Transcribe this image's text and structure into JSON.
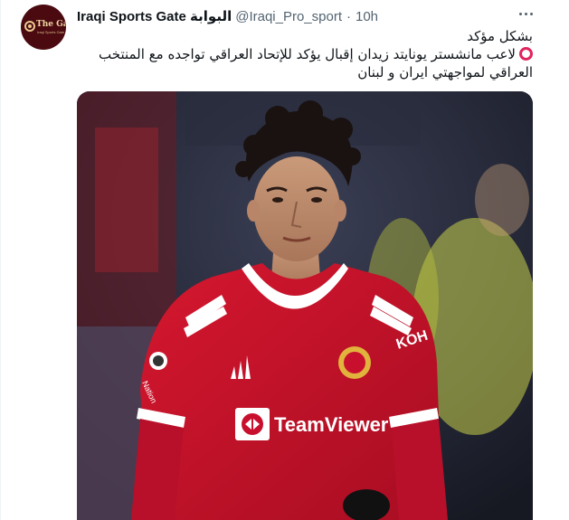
{
  "account": {
    "display_name": "Iraqi Sports Gate البوابة",
    "handle": "@Iraqi_Pro_sport",
    "separator": "·",
    "time": "10h",
    "avatar_text": "The Gate",
    "avatar_subtext": "Iraqi Sports Gate"
  },
  "tweet": {
    "line1": "بشكل مؤكد",
    "line2": "لاعب مانشستر يونايتد زيدان إقبال يؤكد للإتحاد العراقي تواجده مع المنتخب",
    "line3": "العراقي لمواجهتي ايران و لبنان"
  },
  "media": {
    "jersey_sponsor": "TeamViewer",
    "jersey_brand": "KOH",
    "sleeve_text": "Nation"
  },
  "icons": {
    "more": "more-horizontal-icon",
    "bullet": "red-circle-icon"
  },
  "colors": {
    "name": "#0f1419",
    "secondary": "#536471",
    "bullet": "#e0245e",
    "avatar_bg": "#4a0a10",
    "jersey": "#c8102e"
  }
}
